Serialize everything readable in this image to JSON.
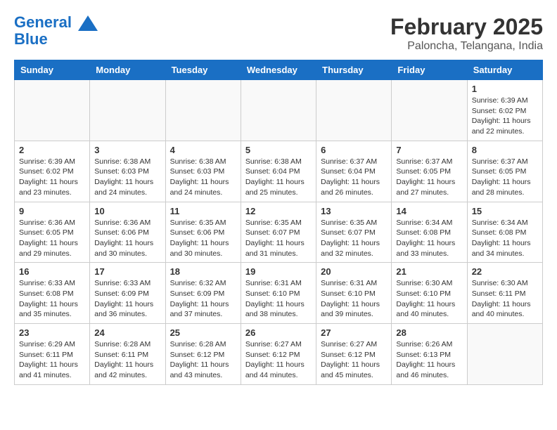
{
  "header": {
    "logo_line1": "General",
    "logo_line2": "Blue",
    "month": "February 2025",
    "location": "Paloncha, Telangana, India"
  },
  "weekdays": [
    "Sunday",
    "Monday",
    "Tuesday",
    "Wednesday",
    "Thursday",
    "Friday",
    "Saturday"
  ],
  "weeks": [
    [
      {
        "day": "",
        "info": ""
      },
      {
        "day": "",
        "info": ""
      },
      {
        "day": "",
        "info": ""
      },
      {
        "day": "",
        "info": ""
      },
      {
        "day": "",
        "info": ""
      },
      {
        "day": "",
        "info": ""
      },
      {
        "day": "1",
        "info": "Sunrise: 6:39 AM\nSunset: 6:02 PM\nDaylight: 11 hours\nand 22 minutes."
      }
    ],
    [
      {
        "day": "2",
        "info": "Sunrise: 6:39 AM\nSunset: 6:02 PM\nDaylight: 11 hours\nand 23 minutes."
      },
      {
        "day": "3",
        "info": "Sunrise: 6:38 AM\nSunset: 6:03 PM\nDaylight: 11 hours\nand 24 minutes."
      },
      {
        "day": "4",
        "info": "Sunrise: 6:38 AM\nSunset: 6:03 PM\nDaylight: 11 hours\nand 24 minutes."
      },
      {
        "day": "5",
        "info": "Sunrise: 6:38 AM\nSunset: 6:04 PM\nDaylight: 11 hours\nand 25 minutes."
      },
      {
        "day": "6",
        "info": "Sunrise: 6:37 AM\nSunset: 6:04 PM\nDaylight: 11 hours\nand 26 minutes."
      },
      {
        "day": "7",
        "info": "Sunrise: 6:37 AM\nSunset: 6:05 PM\nDaylight: 11 hours\nand 27 minutes."
      },
      {
        "day": "8",
        "info": "Sunrise: 6:37 AM\nSunset: 6:05 PM\nDaylight: 11 hours\nand 28 minutes."
      }
    ],
    [
      {
        "day": "9",
        "info": "Sunrise: 6:36 AM\nSunset: 6:05 PM\nDaylight: 11 hours\nand 29 minutes."
      },
      {
        "day": "10",
        "info": "Sunrise: 6:36 AM\nSunset: 6:06 PM\nDaylight: 11 hours\nand 30 minutes."
      },
      {
        "day": "11",
        "info": "Sunrise: 6:35 AM\nSunset: 6:06 PM\nDaylight: 11 hours\nand 30 minutes."
      },
      {
        "day": "12",
        "info": "Sunrise: 6:35 AM\nSunset: 6:07 PM\nDaylight: 11 hours\nand 31 minutes."
      },
      {
        "day": "13",
        "info": "Sunrise: 6:35 AM\nSunset: 6:07 PM\nDaylight: 11 hours\nand 32 minutes."
      },
      {
        "day": "14",
        "info": "Sunrise: 6:34 AM\nSunset: 6:08 PM\nDaylight: 11 hours\nand 33 minutes."
      },
      {
        "day": "15",
        "info": "Sunrise: 6:34 AM\nSunset: 6:08 PM\nDaylight: 11 hours\nand 34 minutes."
      }
    ],
    [
      {
        "day": "16",
        "info": "Sunrise: 6:33 AM\nSunset: 6:08 PM\nDaylight: 11 hours\nand 35 minutes."
      },
      {
        "day": "17",
        "info": "Sunrise: 6:33 AM\nSunset: 6:09 PM\nDaylight: 11 hours\nand 36 minutes."
      },
      {
        "day": "18",
        "info": "Sunrise: 6:32 AM\nSunset: 6:09 PM\nDaylight: 11 hours\nand 37 minutes."
      },
      {
        "day": "19",
        "info": "Sunrise: 6:31 AM\nSunset: 6:10 PM\nDaylight: 11 hours\nand 38 minutes."
      },
      {
        "day": "20",
        "info": "Sunrise: 6:31 AM\nSunset: 6:10 PM\nDaylight: 11 hours\nand 39 minutes."
      },
      {
        "day": "21",
        "info": "Sunrise: 6:30 AM\nSunset: 6:10 PM\nDaylight: 11 hours\nand 40 minutes."
      },
      {
        "day": "22",
        "info": "Sunrise: 6:30 AM\nSunset: 6:11 PM\nDaylight: 11 hours\nand 40 minutes."
      }
    ],
    [
      {
        "day": "23",
        "info": "Sunrise: 6:29 AM\nSunset: 6:11 PM\nDaylight: 11 hours\nand 41 minutes."
      },
      {
        "day": "24",
        "info": "Sunrise: 6:28 AM\nSunset: 6:11 PM\nDaylight: 11 hours\nand 42 minutes."
      },
      {
        "day": "25",
        "info": "Sunrise: 6:28 AM\nSunset: 6:12 PM\nDaylight: 11 hours\nand 43 minutes."
      },
      {
        "day": "26",
        "info": "Sunrise: 6:27 AM\nSunset: 6:12 PM\nDaylight: 11 hours\nand 44 minutes."
      },
      {
        "day": "27",
        "info": "Sunrise: 6:27 AM\nSunset: 6:12 PM\nDaylight: 11 hours\nand 45 minutes."
      },
      {
        "day": "28",
        "info": "Sunrise: 6:26 AM\nSunset: 6:13 PM\nDaylight: 11 hours\nand 46 minutes."
      },
      {
        "day": "",
        "info": ""
      }
    ]
  ]
}
